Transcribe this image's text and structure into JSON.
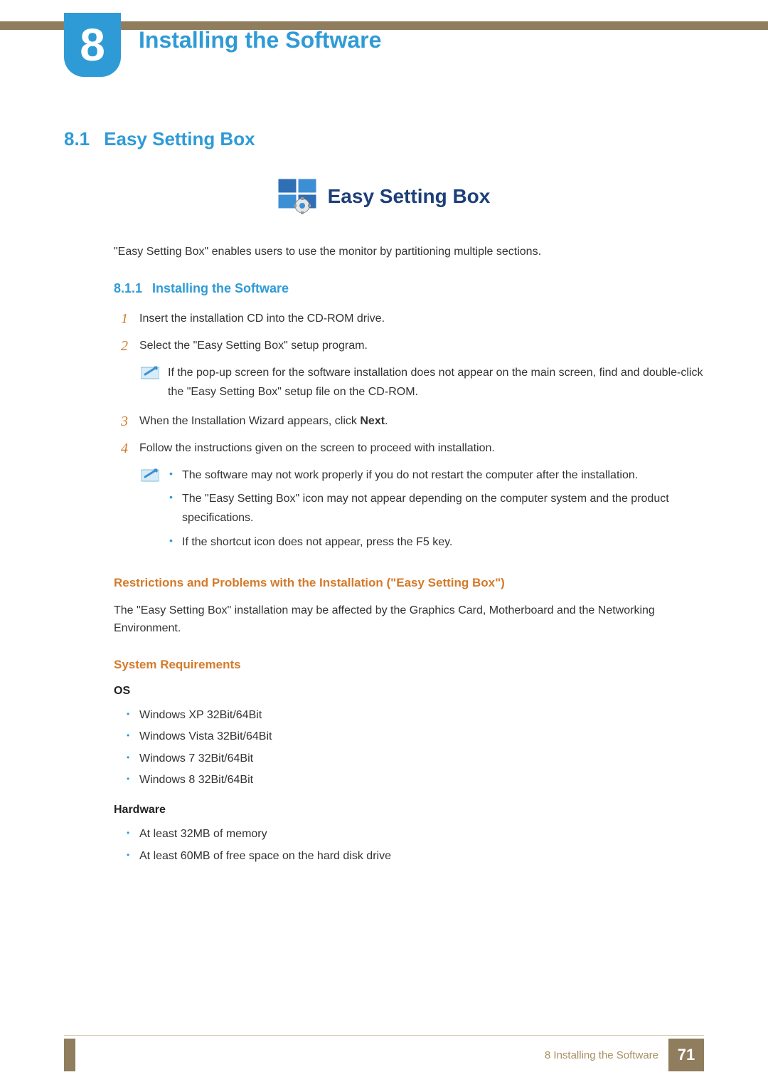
{
  "chapter": {
    "number": "8",
    "title": "Installing the Software"
  },
  "section": {
    "number": "8.1",
    "title": "Easy Setting Box"
  },
  "product": {
    "name": "Easy Setting Box"
  },
  "intro": "\"Easy Setting Box\" enables users to use the monitor by partitioning multiple sections.",
  "subsection": {
    "number": "8.1.1",
    "title": "Installing the Software"
  },
  "steps": {
    "s1": {
      "n": "1",
      "text": "Insert the installation CD into the CD-ROM drive."
    },
    "s2": {
      "n": "2",
      "text": "Select the \"Easy Setting Box\" setup program."
    },
    "note2": "If the pop-up screen for the software installation does not appear on the main screen, find and double-click the \"Easy Setting Box\" setup file on the CD-ROM.",
    "s3": {
      "n": "3",
      "text_pre": "When the Installation Wizard appears, click ",
      "bold": "Next",
      "text_post": "."
    },
    "s4": {
      "n": "4",
      "text": "Follow the instructions given on the screen to proceed with installation."
    },
    "note4": {
      "b1": "The software may not work properly if you do not restart the computer after the installation.",
      "b2": "The \"Easy Setting Box\" icon may not appear depending on the computer system and the product specifications.",
      "b3": "If the shortcut icon does not appear, press the F5 key."
    }
  },
  "restrictions": {
    "heading": "Restrictions and Problems with the Installation (\"Easy Setting Box\")",
    "text": "The \"Easy Setting Box\" installation may be affected by the Graphics Card, Motherboard and the Networking Environment."
  },
  "sysreq": {
    "heading": "System Requirements",
    "os_label": "OS",
    "os": {
      "o1": "Windows XP 32Bit/64Bit",
      "o2": "Windows Vista 32Bit/64Bit",
      "o3": "Windows 7 32Bit/64Bit",
      "o4": "Windows 8 32Bit/64Bit"
    },
    "hw_label": "Hardware",
    "hw": {
      "h1": "At least 32MB of memory",
      "h2": "At least 60MB of free space on the hard disk drive"
    }
  },
  "footer": {
    "chapter_ref": "8 Installing the Software",
    "page": "71"
  }
}
